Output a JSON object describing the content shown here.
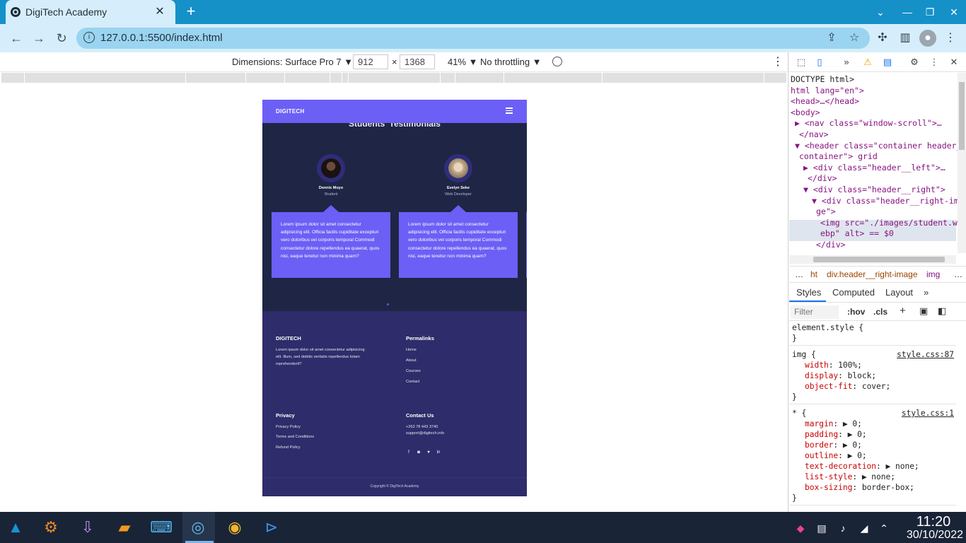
{
  "browser": {
    "tab_title": "DigiTech Academy",
    "tab_close": "✕",
    "new_tab": "+",
    "url": "127.0.0.1:5500/index.html"
  },
  "device_toolbar": {
    "dimensions_label": "Dimensions: Surface Pro 7 ▼",
    "width": "912",
    "times": "×",
    "height": "1368",
    "zoom": "41% ▼",
    "throttling": "No throttling ▼"
  },
  "site": {
    "logo": "DIGITECH",
    "section_title": "Students' Testimonials",
    "testimonials": [
      {
        "name": "Dennis Moyo",
        "role": "Student",
        "text": "Lorem ipsum dolor sit amet consectetur adipisicing elit. Officia facilis cupiditate excepturi vero doloribus vel corporis temporal Commodi consectetur dolore repellendus ea quaerat, quos nisi, eaque tenetur non minima quam?"
      },
      {
        "name": "Evelyn Seke",
        "role": "Web Developer",
        "text": "Lorem ipsum dolor sit amet consectetur adipisicing elit. Officia facilis cupiditate excepturi vero doloribus vel corporis temporal Commodi consectetur dolore repellendus ea quaerat, quos nisi, eaque tenetur non minima quam?"
      }
    ],
    "footer": {
      "brand_title": "DIGITECH",
      "brand_text": "Lorem ipsum dolor sit amet consectetur adipisicing elit. Illum, sed debitis veritatis repellendus totam reprehenderit?",
      "permalinks_title": "Permalinks",
      "permalinks": [
        "Home",
        "About",
        "Courses",
        "Contact"
      ],
      "privacy_title": "Privacy",
      "privacy_links": [
        "Privacy Policy",
        "Terms and Conditions",
        "Refund Policy"
      ],
      "contact_title": "Contact Us",
      "phone": "+263 78 443 3740",
      "email": "support@digitech.info",
      "social": [
        "f",
        "◙",
        "♥",
        "in"
      ],
      "copyright": "Copyright © DigiTech Academy"
    }
  },
  "devtools": {
    "dom_lines": [
      {
        "text": "DOCTYPE html>",
        "cls": "plain",
        "indent": 0
      },
      {
        "text": "html lang=\"en\">",
        "cls": "tag",
        "indent": 0
      },
      {
        "text": "<head>…</head>",
        "cls": "tag",
        "indent": 0
      },
      {
        "text": "<body>",
        "cls": "tag",
        "indent": 0
      },
      {
        "text": "▶ <nav class=\"window-scroll\">…",
        "cls": "tag",
        "indent": 1
      },
      {
        "text": "</nav>",
        "cls": "tag",
        "indent": 2
      },
      {
        "text": "▼ <header class=\"container header__",
        "cls": "tag",
        "indent": 1
      },
      {
        "text": "container\"> grid",
        "cls": "tag",
        "indent": 2
      },
      {
        "text": "▶ <div class=\"header__left\">…",
        "cls": "tag",
        "indent": 3
      },
      {
        "text": "</div>",
        "cls": "tag",
        "indent": 4
      },
      {
        "text": "▼ <div class=\"header__right\">",
        "cls": "tag",
        "indent": 3
      },
      {
        "text": "▼ <div class=\"header__right-ima",
        "cls": "tag",
        "indent": 5
      },
      {
        "text": "ge\">",
        "cls": "tag",
        "indent": 6
      },
      {
        "text": "<img src=\"./images/student.w",
        "cls": "tag",
        "indent": 7
      },
      {
        "text": "ebp\" alt> == $0",
        "cls": "tag",
        "indent": 7
      },
      {
        "text": "</div>",
        "cls": "tag",
        "indent": 6
      }
    ],
    "breadcrumbs": [
      "…",
      "ht",
      "div.header__right-image",
      "img",
      "…"
    ],
    "style_tabs": [
      "Styles",
      "Computed",
      "Layout",
      "»"
    ],
    "filter_placeholder": "Filter",
    "hov": ":hov",
    "cls": ".cls",
    "rules": [
      {
        "selector": "element.style {",
        "source": "",
        "props": []
      },
      {
        "selector": "img {",
        "source": "style.css:87",
        "props": [
          [
            "width",
            "100%;"
          ],
          [
            "display",
            "block;"
          ],
          [
            "object-fit",
            "cover;"
          ]
        ]
      },
      {
        "selector": "* {",
        "source": "style.css:1",
        "props": [
          [
            "margin",
            "▶ 0;"
          ],
          [
            "padding",
            "▶ 0;"
          ],
          [
            "border",
            "▶ 0;"
          ],
          [
            "outline",
            "▶ 0;"
          ],
          [
            "text-decoration",
            "▶ none;"
          ],
          [
            "list-style",
            "▶ none;"
          ],
          [
            "box-sizing",
            "border-box;"
          ]
        ]
      }
    ]
  },
  "taskbar": {
    "time": "11:20",
    "date": "30/10/2022"
  }
}
